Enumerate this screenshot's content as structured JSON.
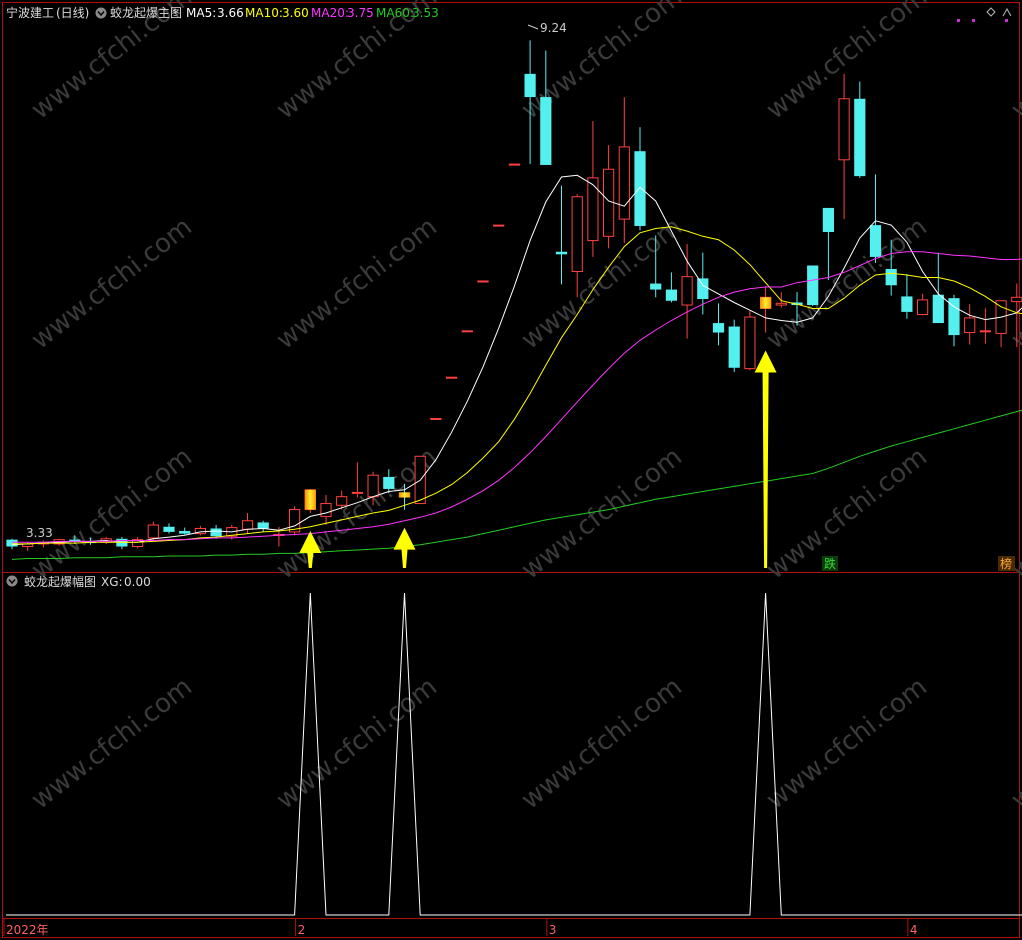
{
  "header": {
    "stock_name": "宁波建工",
    "period": "(日线)",
    "indicator": "蛟龙起爆主图",
    "ma5_label": "MA5:",
    "ma5_value": "3.66",
    "ma10_label": "MA10:",
    "ma10_value": "3.60",
    "ma20_label": "MA20:",
    "ma20_value": "3.75",
    "ma60_label": "MA60:",
    "ma60_value": "3.53"
  },
  "sub_header": {
    "indicator": "蛟龙起爆幅图",
    "xg_label": "XG:",
    "xg_value": "0.00"
  },
  "watermark": "www.cfchi.com",
  "badges": {
    "die": "跌",
    "bang": "榜"
  },
  "colors": {
    "ma5": "#ffffff",
    "ma10": "#ffff00",
    "ma20": "#ff33ff",
    "ma60": "#22cc22",
    "up": "#ff4040",
    "down": "#54f0f0",
    "signal": "#ffcc00",
    "arrow": "#ffff00",
    "frame": "#b01010",
    "watermark": "#3a3a3a"
  },
  "chart_data": [
    {
      "type": "candlestick",
      "title": "蛟龙起爆主图",
      "ylim": [
        3.1,
        9.5
      ],
      "price_labels": {
        "high": "9.24",
        "low": "3.33"
      },
      "candles": [
        {
          "o": 3.43,
          "h": 3.44,
          "l": 3.32,
          "c": 3.35
        },
        {
          "o": 3.35,
          "h": 3.4,
          "l": 3.3,
          "c": 3.38
        },
        {
          "o": 3.38,
          "h": 3.42,
          "l": 3.34,
          "c": 3.4
        },
        {
          "o": 3.38,
          "h": 3.44,
          "l": 3.36,
          "c": 3.43
        },
        {
          "o": 3.43,
          "h": 3.48,
          "l": 3.38,
          "c": 3.41
        },
        {
          "o": 3.41,
          "h": 3.45,
          "l": 3.37,
          "c": 3.39
        },
        {
          "o": 3.4,
          "h": 3.46,
          "l": 3.38,
          "c": 3.44
        },
        {
          "o": 3.44,
          "h": 3.46,
          "l": 3.32,
          "c": 3.35
        },
        {
          "o": 3.35,
          "h": 3.46,
          "l": 3.33,
          "c": 3.43
        },
        {
          "o": 3.45,
          "h": 3.64,
          "l": 3.42,
          "c": 3.6
        },
        {
          "o": 3.58,
          "h": 3.62,
          "l": 3.5,
          "c": 3.52
        },
        {
          "o": 3.53,
          "h": 3.57,
          "l": 3.49,
          "c": 3.5
        },
        {
          "o": 3.5,
          "h": 3.59,
          "l": 3.48,
          "c": 3.56
        },
        {
          "o": 3.56,
          "h": 3.6,
          "l": 3.44,
          "c": 3.47
        },
        {
          "o": 3.47,
          "h": 3.6,
          "l": 3.43,
          "c": 3.57
        },
        {
          "o": 3.55,
          "h": 3.74,
          "l": 3.5,
          "c": 3.65
        },
        {
          "o": 3.63,
          "h": 3.65,
          "l": 3.52,
          "c": 3.56
        },
        {
          "o": 3.48,
          "h": 3.58,
          "l": 3.35,
          "c": 3.49
        },
        {
          "o": 3.52,
          "h": 3.82,
          "l": 3.48,
          "c": 3.78
        },
        {
          "o": 3.78,
          "h": 4.02,
          "l": 3.74,
          "c": 4.01
        },
        {
          "o": 3.7,
          "h": 3.95,
          "l": 3.6,
          "c": 3.85
        },
        {
          "o": 3.83,
          "h": 4.0,
          "l": 3.78,
          "c": 3.93
        },
        {
          "o": 3.97,
          "h": 4.33,
          "l": 3.92,
          "c": 3.98
        },
        {
          "o": 3.93,
          "h": 4.22,
          "l": 3.83,
          "c": 4.18
        },
        {
          "o": 4.16,
          "h": 4.25,
          "l": 3.97,
          "c": 4.02
        },
        {
          "o": 3.98,
          "h": 4.08,
          "l": 3.78,
          "c": 3.92
        },
        {
          "o": 3.85,
          "h": 4.4,
          "l": 3.85,
          "c": 4.4
        },
        {
          "o": 4.84,
          "h": 4.84,
          "l": 4.84,
          "c": 4.84
        },
        {
          "o": 5.32,
          "h": 5.32,
          "l": 5.32,
          "c": 5.32
        },
        {
          "o": 5.86,
          "h": 5.86,
          "l": 5.86,
          "c": 5.86
        },
        {
          "o": 6.44,
          "h": 6.44,
          "l": 6.44,
          "c": 6.44
        },
        {
          "o": 7.09,
          "h": 7.09,
          "l": 7.09,
          "c": 7.09
        },
        {
          "o": 7.8,
          "h": 7.8,
          "l": 7.8,
          "c": 7.8
        },
        {
          "o": 8.85,
          "h": 9.24,
          "l": 7.8,
          "c": 8.58
        },
        {
          "o": 8.58,
          "h": 9.12,
          "l": 7.79,
          "c": 7.79
        },
        {
          "o": 6.78,
          "h": 7.55,
          "l": 6.4,
          "c": 6.75
        },
        {
          "o": 6.55,
          "h": 7.45,
          "l": 6.25,
          "c": 7.42
        },
        {
          "o": 6.91,
          "h": 8.3,
          "l": 6.72,
          "c": 7.64
        },
        {
          "o": 6.96,
          "h": 8.02,
          "l": 6.82,
          "c": 7.74
        },
        {
          "o": 7.16,
          "h": 8.58,
          "l": 6.88,
          "c": 8.0
        },
        {
          "o": 7.95,
          "h": 8.23,
          "l": 7.03,
          "c": 7.08
        },
        {
          "o": 6.41,
          "h": 6.97,
          "l": 6.25,
          "c": 6.34
        },
        {
          "o": 6.34,
          "h": 6.54,
          "l": 6.19,
          "c": 6.21
        },
        {
          "o": 6.16,
          "h": 6.87,
          "l": 5.77,
          "c": 6.49
        },
        {
          "o": 6.47,
          "h": 6.77,
          "l": 6.05,
          "c": 6.23
        },
        {
          "o": 5.95,
          "h": 6.18,
          "l": 5.69,
          "c": 5.84
        },
        {
          "o": 5.91,
          "h": 5.99,
          "l": 5.38,
          "c": 5.43
        },
        {
          "o": 5.42,
          "h": 6.09,
          "l": 5.4,
          "c": 6.02
        },
        {
          "o": 6.12,
          "h": 6.38,
          "l": 5.84,
          "c": 6.25
        },
        {
          "o": 6.16,
          "h": 6.31,
          "l": 6.13,
          "c": 6.18
        },
        {
          "o": 6.19,
          "h": 6.31,
          "l": 5.92,
          "c": 6.16
        },
        {
          "o": 6.62,
          "h": 6.62,
          "l": 6.15,
          "c": 6.16
        },
        {
          "o": 7.29,
          "h": 7.29,
          "l": 6.45,
          "c": 7.01
        },
        {
          "o": 7.85,
          "h": 8.85,
          "l": 7.16,
          "c": 8.56
        },
        {
          "o": 8.56,
          "h": 8.76,
          "l": 7.64,
          "c": 7.66
        },
        {
          "o": 7.09,
          "h": 7.68,
          "l": 6.65,
          "c": 6.72
        },
        {
          "o": 6.58,
          "h": 6.92,
          "l": 6.27,
          "c": 6.39
        },
        {
          "o": 6.26,
          "h": 6.52,
          "l": 6.0,
          "c": 6.08
        },
        {
          "o": 6.05,
          "h": 6.29,
          "l": 6.04,
          "c": 6.22
        },
        {
          "o": 6.28,
          "h": 6.77,
          "l": 6.23,
          "c": 5.95
        },
        {
          "o": 6.24,
          "h": 6.28,
          "l": 5.68,
          "c": 5.81
        },
        {
          "o": 5.84,
          "h": 6.17,
          "l": 5.7,
          "c": 6.01
        },
        {
          "o": 5.86,
          "h": 6.12,
          "l": 5.71,
          "c": 5.86
        },
        {
          "o": 5.83,
          "h": 6.21,
          "l": 5.67,
          "c": 6.21
        },
        {
          "o": 6.2,
          "h": 6.41,
          "l": 5.67,
          "c": 6.25
        },
        {
          "o": 6.27,
          "h": 7.02,
          "l": 6.13,
          "c": 6.76
        }
      ],
      "series": [
        {
          "name": "MA5",
          "values": [
            3.37,
            3.38,
            3.39,
            3.4,
            3.41,
            3.41,
            3.42,
            3.4,
            3.4,
            3.44,
            3.46,
            3.48,
            3.52,
            3.53,
            3.52,
            3.55,
            3.56,
            3.54,
            3.59,
            3.7,
            3.74,
            3.8,
            3.86,
            3.93,
            3.99,
            4.01,
            4.12,
            4.36,
            4.68,
            5.04,
            5.44,
            5.89,
            6.38,
            6.91,
            7.36,
            7.65,
            7.67,
            7.56,
            7.37,
            7.31,
            7.53,
            7.37,
            7.02,
            6.67,
            6.39,
            6.29,
            6.19,
            6.1,
            6.01,
            5.98,
            5.96,
            6.01,
            6.26,
            6.59,
            6.94,
            7.14,
            7.09,
            6.89,
            6.55,
            6.29,
            6.14,
            6.04,
            5.99,
            6.02,
            6.07,
            6.24
          ]
        },
        {
          "name": "MA10",
          "values": [
            3.38,
            3.38,
            3.39,
            3.39,
            3.39,
            3.4,
            3.4,
            3.4,
            3.4,
            3.41,
            3.42,
            3.43,
            3.45,
            3.46,
            3.48,
            3.5,
            3.52,
            3.53,
            3.55,
            3.58,
            3.62,
            3.66,
            3.7,
            3.74,
            3.77,
            3.83,
            3.89,
            3.97,
            4.07,
            4.21,
            4.38,
            4.57,
            4.83,
            5.13,
            5.46,
            5.78,
            6.05,
            6.34,
            6.6,
            6.84,
            7.0,
            7.05,
            7.07,
            7.02,
            6.96,
            6.92,
            6.8,
            6.63,
            6.42,
            6.21,
            6.17,
            6.12,
            6.12,
            6.24,
            6.39,
            6.51,
            6.53,
            6.51,
            6.48,
            6.48,
            6.44,
            6.36,
            6.26,
            6.14,
            6.07,
            6.04
          ]
        },
        {
          "name": "MA20",
          "values": [
            3.4,
            3.4,
            3.4,
            3.41,
            3.41,
            3.41,
            3.41,
            3.42,
            3.42,
            3.42,
            3.43,
            3.43,
            3.44,
            3.45,
            3.45,
            3.46,
            3.47,
            3.48,
            3.49,
            3.5,
            3.52,
            3.54,
            3.56,
            3.58,
            3.61,
            3.65,
            3.69,
            3.74,
            3.81,
            3.9,
            4.0,
            4.12,
            4.27,
            4.44,
            4.63,
            4.83,
            5.03,
            5.23,
            5.42,
            5.6,
            5.75,
            5.87,
            5.98,
            6.08,
            6.17,
            6.25,
            6.31,
            6.35,
            6.37,
            6.37,
            6.42,
            6.45,
            6.48,
            6.54,
            6.62,
            6.7,
            6.76,
            6.78,
            6.78,
            6.76,
            6.74,
            6.73,
            6.71,
            6.69,
            6.69,
            6.71
          ]
        },
        {
          "name": "MA60",
          "values": [
            3.2,
            3.21,
            3.21,
            3.21,
            3.22,
            3.22,
            3.22,
            3.23,
            3.23,
            3.23,
            3.24,
            3.24,
            3.24,
            3.25,
            3.25,
            3.26,
            3.26,
            3.27,
            3.27,
            3.28,
            3.29,
            3.3,
            3.31,
            3.32,
            3.33,
            3.35,
            3.37,
            3.4,
            3.43,
            3.46,
            3.5,
            3.54,
            3.58,
            3.62,
            3.66,
            3.69,
            3.72,
            3.75,
            3.78,
            3.82,
            3.86,
            3.9,
            3.93,
            3.96,
            3.99,
            4.02,
            4.05,
            4.08,
            4.11,
            4.14,
            4.17,
            4.2,
            4.26,
            4.33,
            4.4,
            4.46,
            4.52,
            4.57,
            4.62,
            4.67,
            4.72,
            4.77,
            4.82,
            4.87,
            4.92,
            4.97
          ]
        }
      ],
      "signal_bars": [
        19,
        25,
        48
      ],
      "signal_arrows": [
        19,
        25,
        48
      ]
    },
    {
      "type": "line",
      "title": "蛟龙起爆幅图",
      "name": "XG",
      "ylim": [
        0,
        1
      ],
      "x_ticks": [
        {
          "index": 0,
          "label": "2022年"
        },
        {
          "index": 18,
          "label": "2"
        },
        {
          "index": 34,
          "label": "3"
        },
        {
          "index": 57,
          "label": "4"
        }
      ],
      "pulses": [
        19,
        25,
        48
      ]
    }
  ]
}
